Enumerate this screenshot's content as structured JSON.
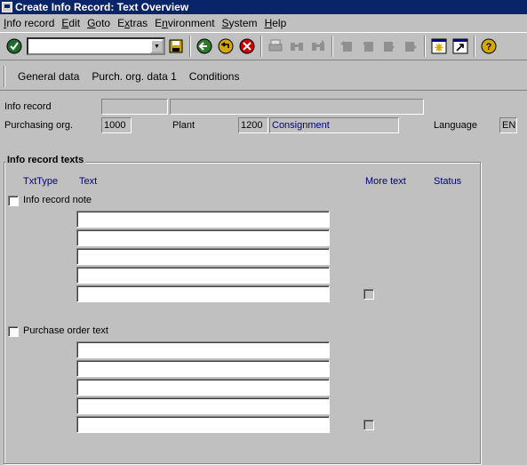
{
  "window": {
    "title": "Create Info Record: Text Overview"
  },
  "menu": [
    {
      "pre": "",
      "acc": "I",
      "post": "nfo record"
    },
    {
      "pre": "",
      "acc": "E",
      "post": "dit"
    },
    {
      "pre": "",
      "acc": "G",
      "post": "oto"
    },
    {
      "pre": "E",
      "acc": "x",
      "post": "tras"
    },
    {
      "pre": "E",
      "acc": "n",
      "post": "vironment"
    },
    {
      "pre": "",
      "acc": "S",
      "post": "ystem"
    },
    {
      "pre": "",
      "acc": "H",
      "post": "elp"
    }
  ],
  "toolbar": {
    "command_value": "",
    "icons": [
      "enter-icon",
      "save-icon",
      "back-icon",
      "exit-icon",
      "cancel-icon",
      "print-icon",
      "find-icon",
      "find-next-icon",
      "first-page-icon",
      "previous-page-icon",
      "next-page-icon",
      "last-page-icon",
      "create-session-icon",
      "shortcut-icon",
      "help-icon"
    ]
  },
  "appbar": {
    "general_data": "General data",
    "purch_org_data": "Purch. org. data 1",
    "conditions": "Conditions"
  },
  "header": {
    "info_record_label": "Info record",
    "info_record_value": "",
    "info_record_desc": "",
    "purch_org_label": "Purchasing org.",
    "purch_org_value": "1000",
    "plant_label": "Plant",
    "plant_value": "1200",
    "category_value": "Consignment",
    "language_label": "Language",
    "language_value": "EN"
  },
  "texts": {
    "group_title": "Info record texts",
    "col_txttype": "TxtType",
    "col_text": "Text",
    "col_more": "More text",
    "col_status": "Status",
    "info_note_label": "Info record note",
    "po_text_label": "Purchase order text"
  }
}
